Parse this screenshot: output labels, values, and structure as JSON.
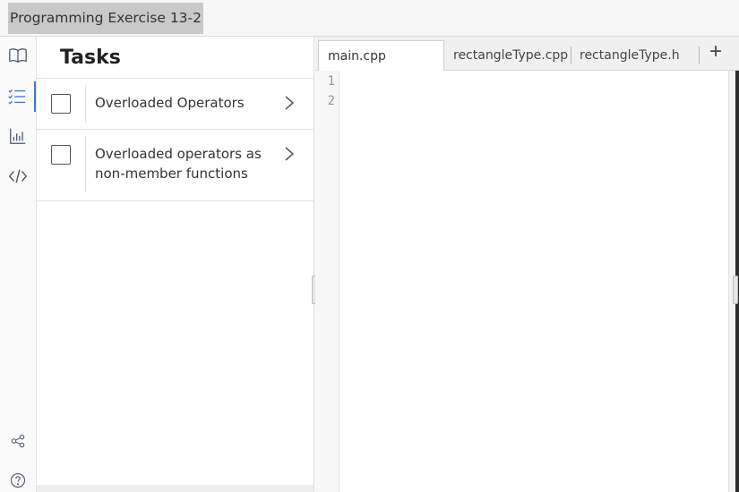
{
  "window": {
    "title": "Programming Exercise 13-2"
  },
  "rail": {
    "items": [
      {
        "icon": "book-icon",
        "label": "Instructions"
      },
      {
        "icon": "checklist-icon",
        "label": "Tasks",
        "active": true
      },
      {
        "icon": "bar-chart-icon",
        "label": "Results"
      },
      {
        "icon": "code-icon",
        "label": "Code"
      },
      {
        "icon": "share-icon",
        "label": "Share"
      },
      {
        "icon": "help-icon",
        "label": "Help"
      }
    ]
  },
  "tasks": {
    "title": "Tasks",
    "items": [
      {
        "label": "Overloaded Operators",
        "checked": false
      },
      {
        "label": "Overloaded operators as non-member functions",
        "checked": false
      }
    ]
  },
  "editor": {
    "tabs": [
      {
        "label": "main.cpp",
        "active": true
      },
      {
        "label": "rectangleType.cpp",
        "active": false
      },
      {
        "label": "rectangleType.h",
        "active": false
      }
    ],
    "add_tab_label": "+",
    "line_numbers": [
      "1",
      "2"
    ]
  }
}
